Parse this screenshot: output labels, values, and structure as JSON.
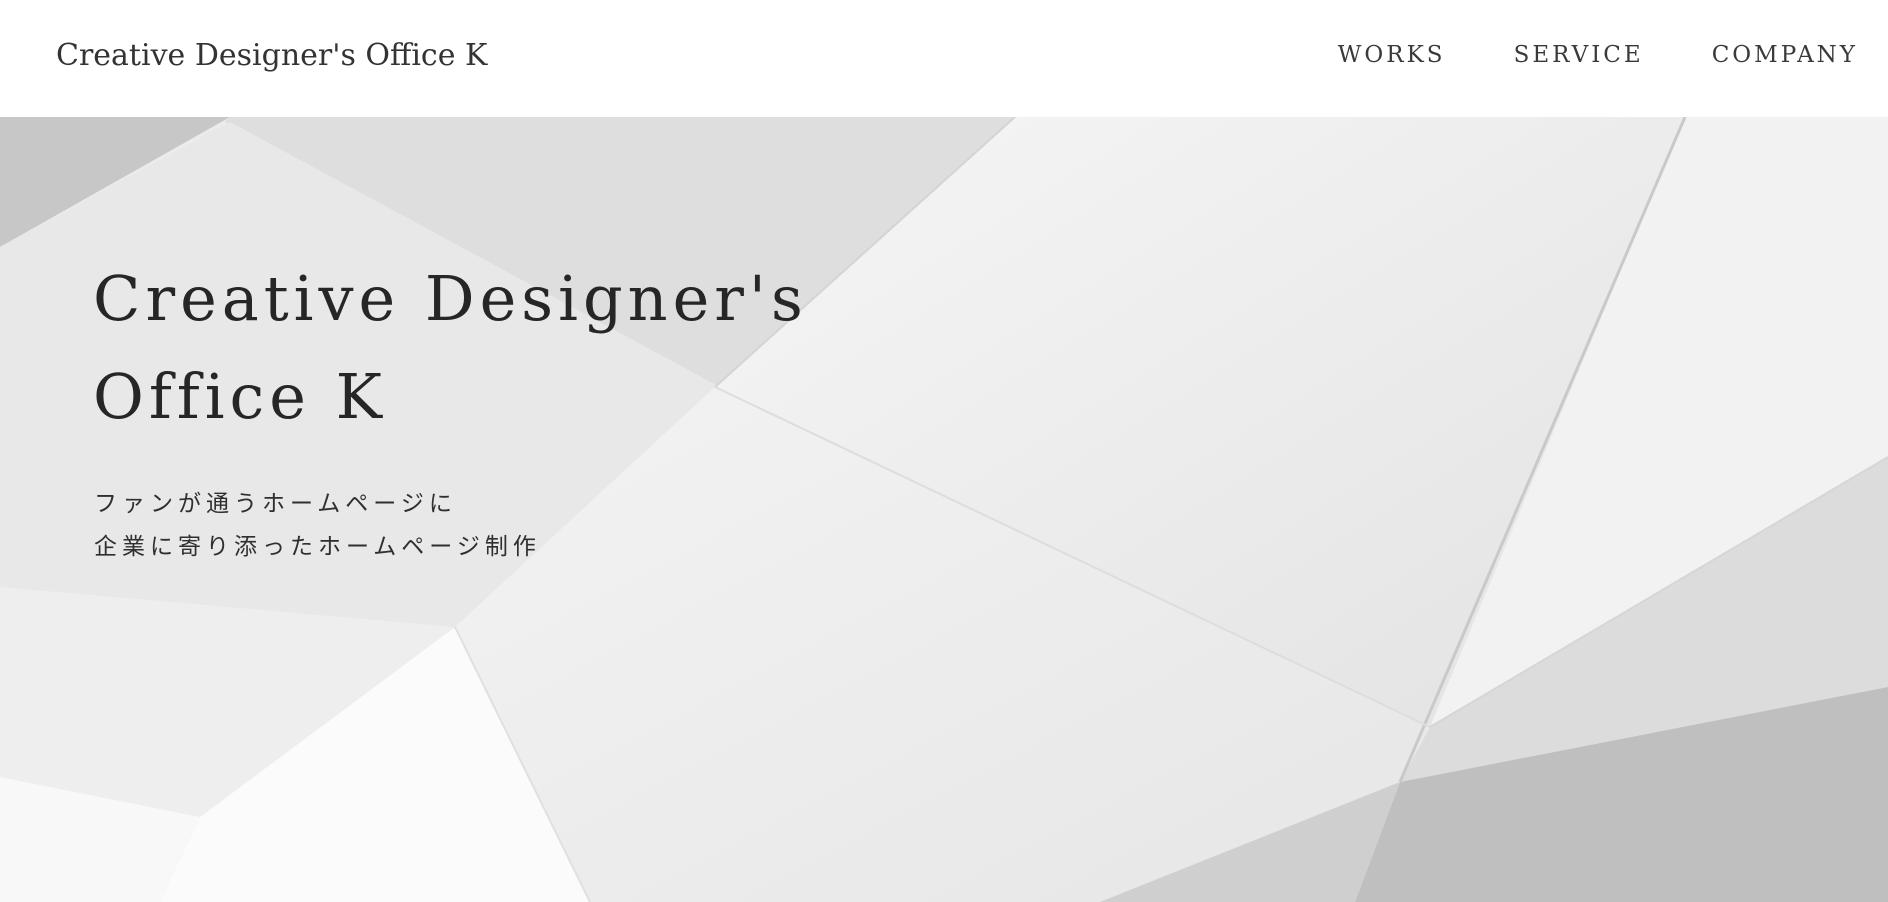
{
  "header": {
    "logo_text": "Creative Designer's Office K",
    "nav": [
      {
        "label": "WORKS"
      },
      {
        "label": "SERVICE"
      },
      {
        "label": "COMPANY"
      }
    ]
  },
  "hero": {
    "title_line1": "Creative Designer's",
    "title_line2": "Office K",
    "tagline_line1": "ファンが通うホームページに",
    "tagline_line2": "企業に寄り添ったホームページ制作"
  }
}
